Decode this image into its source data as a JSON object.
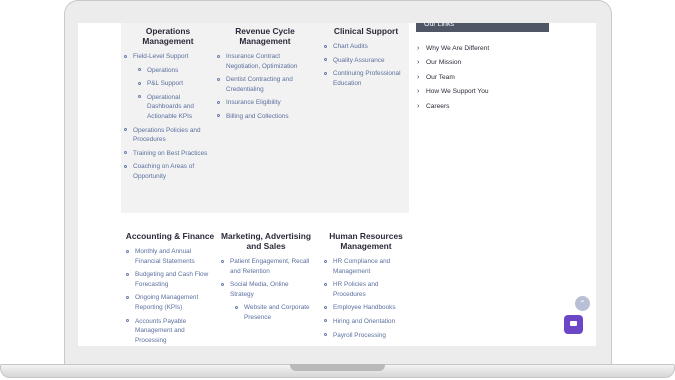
{
  "sections": {
    "operations": {
      "title": "Operations Management",
      "items": [
        "Field-Level Support"
      ],
      "sub_items": [
        "Operations",
        "P&L Support",
        "Operational Dashboards and Actionable KPIs"
      ],
      "items_after": [
        "Operations Policies and Procedures",
        "Training on Best Practices",
        "Coaching on Areas of Opportunity"
      ]
    },
    "revenue": {
      "title": "Revenue Cycle Management",
      "items": [
        "Insurance Contract Negotiation, Optimization",
        "Dentist Contracting and Credentialing",
        "Insurance Eligibility",
        "Billing and Collections"
      ]
    },
    "clinical": {
      "title": "Clinical Support",
      "items": [
        "Chart Audits",
        "Quality Assurance",
        "Continuing Professional Education"
      ]
    },
    "accounting": {
      "title": "Accounting & Finance",
      "items": [
        "Monthly and Annual Financial Statements",
        "Budgeting and Cash Flow Forecasting",
        "Ongoing Management Reporting (KPIs)",
        "Accounts Payable Management and Processing"
      ]
    },
    "marketing": {
      "title": "Marketing, Advertising and Sales",
      "items": [
        "Patient Engagement, Recall and Retention",
        "Social Media, Online Strategy"
      ],
      "sub_items": [
        "Website and Corporate Presence"
      ]
    },
    "hr": {
      "title": "Human Resources Management",
      "items": [
        "HR Compliance and Management",
        "HR Policies and Procedures",
        "Employee Handbooks",
        "Hiring and Orientation",
        "Payroll Processing"
      ]
    }
  },
  "sidebar": {
    "header": "Our Links",
    "links": [
      "Why We Are Different",
      "Our Mission",
      "Our Team",
      "How We Support You",
      "Careers"
    ]
  },
  "icons": {
    "scroll_top": "chevron-up-icon",
    "chat": "chat-icon",
    "link_chevron": "chevron-right-icon"
  },
  "colors": {
    "link_blue": "#5b6f9e",
    "chat_purple": "#6b47c7",
    "sidebar_header": "#4f5666",
    "panel_gray": "#f2f2f2"
  }
}
